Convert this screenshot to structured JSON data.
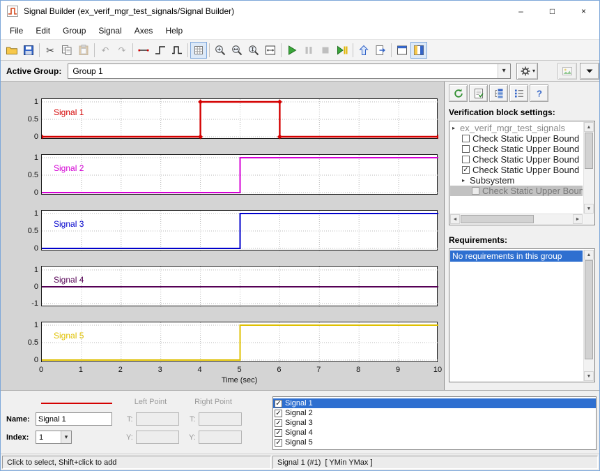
{
  "icons": {
    "combo_arrow": "▾",
    "check": "✓",
    "scroll_up": "▲",
    "scroll_down": "▼",
    "scroll_left": "◄",
    "scroll_right": "►"
  },
  "window": {
    "title": "Signal Builder (ex_verif_mgr_test_signals/Signal Builder)",
    "controls": {
      "minimize": "–",
      "maximize": "□",
      "close": "×"
    }
  },
  "menu": [
    "File",
    "Edit",
    "Group",
    "Signal",
    "Axes",
    "Help"
  ],
  "toolbar": [
    {
      "name": "open-button",
      "icon": "open-folder"
    },
    {
      "name": "save-button",
      "icon": "save"
    },
    {
      "sep": true
    },
    {
      "name": "cut-button",
      "icon": "cut"
    },
    {
      "name": "copy-button",
      "icon": "copy"
    },
    {
      "name": "paste-button",
      "icon": "paste",
      "disabled": true
    },
    {
      "sep": true
    },
    {
      "name": "undo-button",
      "icon": "undo",
      "disabled": true
    },
    {
      "name": "redo-button",
      "icon": "redo",
      "disabled": true
    },
    {
      "sep": true
    },
    {
      "name": "draw-line-button",
      "icon": "draw-line"
    },
    {
      "name": "draw-step-button",
      "icon": "draw-step"
    },
    {
      "name": "draw-pulse-button",
      "icon": "draw-pulse"
    },
    {
      "sep": true
    },
    {
      "name": "snap-to-grid-button",
      "icon": "grid",
      "pressed": true
    },
    {
      "sep": true
    },
    {
      "name": "zoom-in-xy-button",
      "icon": "zoom-xy"
    },
    {
      "name": "zoom-in-t-button",
      "icon": "zoom-t"
    },
    {
      "name": "zoom-in-y-button",
      "icon": "zoom-y"
    },
    {
      "name": "fit-to-view-button",
      "icon": "fit-view"
    },
    {
      "sep": true
    },
    {
      "name": "run-button",
      "icon": "run"
    },
    {
      "name": "pause-button",
      "icon": "pause",
      "disabled": true
    },
    {
      "name": "stop-button",
      "icon": "stop",
      "disabled": true
    },
    {
      "name": "run-all-button",
      "icon": "run-all"
    },
    {
      "sep": true
    },
    {
      "name": "up-to-parent-button",
      "icon": "up-arrow"
    },
    {
      "name": "open-model-button",
      "icon": "open-model"
    },
    {
      "sep": true
    },
    {
      "name": "dock-button",
      "icon": "dock"
    },
    {
      "name": "show-verification-panel-button",
      "icon": "panel",
      "pressed": true
    }
  ],
  "active_group": {
    "label": "Active Group:",
    "value": "Group 1"
  },
  "right_toolbar": [
    {
      "name": "refresh-verification-button",
      "icon": "refresh"
    },
    {
      "name": "show-requirements-button",
      "icon": "doc-check"
    },
    {
      "name": "tree-view-button",
      "icon": "tree"
    },
    {
      "name": "list-view-button",
      "icon": "list"
    },
    {
      "name": "verification-help-button",
      "icon": "help"
    }
  ],
  "verification": {
    "title": "Verification block settings:",
    "tree": [
      {
        "label": "ex_verif_mgr_test_signals",
        "root": true,
        "expander": "▸"
      },
      {
        "label": "Check Static Upper Bound",
        "checkbox": true,
        "checked": false,
        "indent": 1
      },
      {
        "label": "Check Static Upper Bound",
        "checkbox": true,
        "checked": false,
        "indent": 1
      },
      {
        "label": "Check Static Upper Bound",
        "checkbox": true,
        "checked": false,
        "indent": 1
      },
      {
        "label": "Check Static Upper Bound",
        "checkbox": true,
        "checked": true,
        "indent": 1
      },
      {
        "label": "Subsystem",
        "expander": "▸",
        "indent": 1
      },
      {
        "label": "Check Static Upper Bound",
        "checkbox": true,
        "checked": false,
        "indent": 2,
        "disabled": true,
        "highlighted": true
      }
    ]
  },
  "requirements": {
    "title": "Requirements:",
    "items": [
      {
        "label": "No requirements in this group",
        "selected": true
      }
    ]
  },
  "editor": {
    "left_point_label": "Left Point",
    "right_point_label": "Right Point",
    "name_label": "Name:",
    "name_value": "Signal 1",
    "index_label": "Index:",
    "index_value": "1",
    "t_label": "T:",
    "y_label": "Y:",
    "selected_signal_color": "#d40000"
  },
  "signal_list": [
    {
      "label": "Signal 1",
      "checked": true,
      "selected": true
    },
    {
      "label": "Signal 2",
      "checked": true,
      "selected": false
    },
    {
      "label": "Signal 3",
      "checked": true,
      "selected": false
    },
    {
      "label": "Signal 4",
      "checked": true,
      "selected": false
    },
    {
      "label": "Signal 5",
      "checked": true,
      "selected": false
    }
  ],
  "status": {
    "left": "Click to select, Shift+click to add",
    "right": "Signal 1 (#1)  [ YMin YMax ]"
  },
  "chart_data": {
    "type": "line",
    "title": "",
    "xlabel": "Time (sec)",
    "xlim": [
      0,
      10
    ],
    "xticks": [
      0,
      1,
      2,
      3,
      4,
      5,
      6,
      7,
      8,
      9,
      10
    ],
    "grid": true,
    "legend": "none",
    "signals": [
      {
        "name": "Signal 1",
        "color": "#d40000",
        "x": [
          0,
          4,
          4,
          6,
          6,
          10
        ],
        "y": [
          0,
          0,
          1,
          1,
          0,
          0
        ],
        "yticks": [
          0,
          0.5,
          1
        ],
        "ylim": [
          -0.08,
          1.08
        ],
        "selected": true,
        "markers": true
      },
      {
        "name": "Signal 2",
        "color": "#d400d4",
        "x": [
          0,
          5,
          5,
          10
        ],
        "y": [
          0,
          0,
          1,
          1
        ],
        "yticks": [
          0,
          0.5,
          1
        ],
        "ylim": [
          -0.08,
          1.08
        ],
        "selected": false,
        "markers": false
      },
      {
        "name": "Signal 3",
        "color": "#0000cc",
        "x": [
          0,
          5,
          5,
          10
        ],
        "y": [
          0,
          0,
          1,
          1
        ],
        "yticks": [
          0,
          0.5,
          1
        ],
        "ylim": [
          -0.08,
          1.08
        ],
        "selected": false,
        "markers": false
      },
      {
        "name": "Signal 4",
        "color": "#550055",
        "x": [
          0,
          10
        ],
        "y": [
          0,
          0
        ],
        "yticks": [
          -1,
          0,
          1
        ],
        "ylim": [
          -1.2,
          1.2
        ],
        "selected": false,
        "markers": false
      },
      {
        "name": "Signal 5",
        "color": "#dfc000",
        "x": [
          0,
          5,
          5,
          10
        ],
        "y": [
          0,
          0,
          1,
          1
        ],
        "yticks": [
          0,
          0.5,
          1
        ],
        "ylim": [
          -0.08,
          1.08
        ],
        "selected": false,
        "markers": false
      }
    ]
  }
}
